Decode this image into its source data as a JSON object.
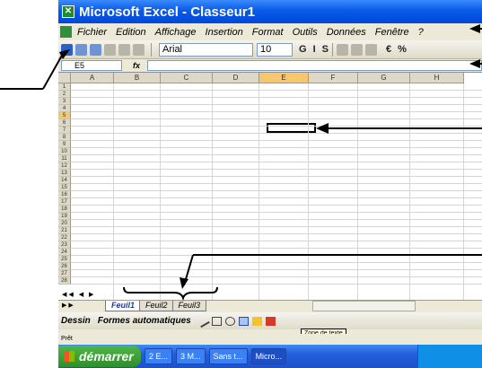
{
  "window": {
    "title": "Microsoft Excel - Classeur1"
  },
  "menu": [
    "Fichier",
    "Edition",
    "Affichage",
    "Insertion",
    "Format",
    "Outils",
    "Données",
    "Fenêtre",
    "?"
  ],
  "toolbar": {
    "font": "Arial",
    "size": "10",
    "format_buttons": [
      "G",
      "I",
      "S",
      "€",
      "%"
    ]
  },
  "formula_bar": {
    "cell_ref": "E5",
    "fx": "fx"
  },
  "grid": {
    "columns": [
      "A",
      "B",
      "C",
      "D",
      "E",
      "F",
      "G",
      "H"
    ],
    "rows": [
      "1",
      "2",
      "3",
      "4",
      "5",
      "6",
      "7",
      "8",
      "9",
      "10",
      "11",
      "12",
      "13",
      "14",
      "15",
      "16",
      "17",
      "18",
      "19",
      "20",
      "21",
      "22",
      "23",
      "24",
      "25",
      "26",
      "27",
      "28"
    ],
    "selected_column": "E",
    "selected_row": "5"
  },
  "sheets": [
    "Feuil1",
    "Feuil2",
    "Feuil3"
  ],
  "active_sheet": "Feuil1",
  "drawing": {
    "dessin": "Dessin",
    "formes": "Formes automatiques",
    "tooltip": "Zone de texte"
  },
  "status": "Prêt",
  "taskbar": {
    "start": "démarrer",
    "items": [
      "2 E...",
      "3 M...",
      "Sans t...",
      "Micro..."
    ]
  }
}
